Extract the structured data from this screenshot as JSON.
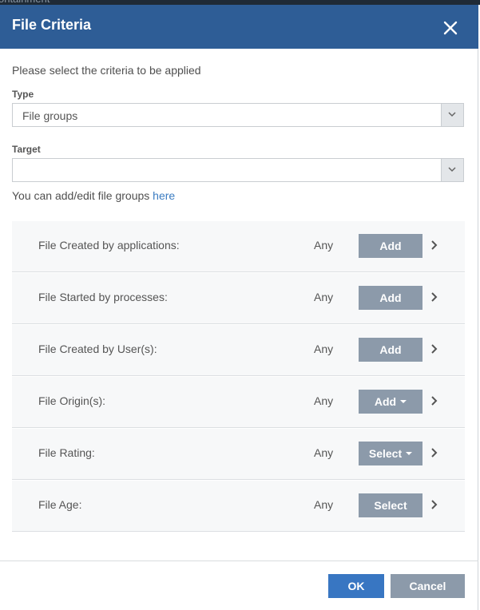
{
  "backdrop": {
    "text": "ontainment"
  },
  "dialog": {
    "title": "File Criteria",
    "instruction": "Please select the criteria to be applied",
    "type": {
      "label": "Type",
      "value": "File groups"
    },
    "target": {
      "label": "Target",
      "value": ""
    },
    "hint": {
      "text": "You can add/edit file groups ",
      "link": "here"
    },
    "criteria": [
      {
        "label": "File Created by applications:",
        "value": "Any",
        "button": "Add"
      },
      {
        "label": "File Started by processes:",
        "value": "Any",
        "button": "Add"
      },
      {
        "label": "File Created by User(s):",
        "value": "Any",
        "button": "Add"
      },
      {
        "label": "File Origin(s):",
        "value": "Any",
        "button": "Add"
      },
      {
        "label": "File Rating:",
        "value": "Any",
        "button": "Select"
      },
      {
        "label": "File Age:",
        "value": "Any",
        "button": "Select"
      }
    ],
    "footer": {
      "ok": "OK",
      "cancel": "Cancel"
    }
  },
  "colors": {
    "header": "#2e5d96",
    "primary_button": "#3876c2",
    "secondary_button": "#8c9aaa",
    "link": "#3b7cc2"
  }
}
